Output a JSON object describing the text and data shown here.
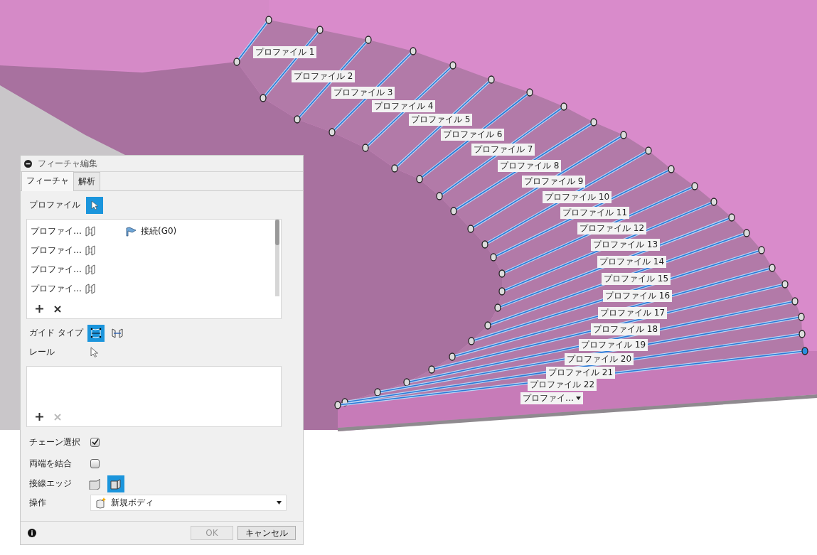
{
  "viewport": {
    "profiles": [
      {
        "label": "プロファイル 1",
        "kind": "label"
      },
      {
        "label": "プロファイル 2",
        "kind": "label"
      },
      {
        "label": "プロファイル 3",
        "kind": "label"
      },
      {
        "label": "プロファイル 4",
        "kind": "label"
      },
      {
        "label": "プロファイル 5",
        "kind": "label"
      },
      {
        "label": "プロファイル 6",
        "kind": "label"
      },
      {
        "label": "プロファイル 7",
        "kind": "label"
      },
      {
        "label": "プロファイル 8",
        "kind": "label"
      },
      {
        "label": "プロファイル 9",
        "kind": "label"
      },
      {
        "label": "プロファイル 10",
        "kind": "label"
      },
      {
        "label": "プロファイル 11",
        "kind": "label"
      },
      {
        "label": "プロファイル 12",
        "kind": "label"
      },
      {
        "label": "プロファイル 13",
        "kind": "label"
      },
      {
        "label": "プロファイル 14",
        "kind": "label"
      },
      {
        "label": "プロファイル 15",
        "kind": "label"
      },
      {
        "label": "プロファイル 16",
        "kind": "label"
      },
      {
        "label": "プロファイル 17",
        "kind": "label"
      },
      {
        "label": "プロファイル 18",
        "kind": "label"
      },
      {
        "label": "プロファイル 19",
        "kind": "label"
      },
      {
        "label": "プロファイル 20",
        "kind": "label"
      },
      {
        "label": "プロファイル 21",
        "kind": "label"
      },
      {
        "label": "プロファイル 22",
        "kind": "label"
      },
      {
        "label": "プロファイ…",
        "kind": "dropdown"
      }
    ]
  },
  "dialog": {
    "title": "フィーチャ編集",
    "tabs": [
      {
        "label": "フィーチャ",
        "selected": true
      },
      {
        "label": "解析",
        "selected": false
      }
    ],
    "profile_label": "プロファイル",
    "profile_rows": [
      {
        "name": "プロファイ…",
        "condition": "接続(G0)"
      },
      {
        "name": "プロファイ…"
      },
      {
        "name": "プロファイ…"
      },
      {
        "name": "プロファイ…"
      }
    ],
    "profile_list": {
      "remove_disabled": false
    },
    "guide_type": {
      "label": "ガイド タイプ",
      "options": [
        {
          "kind": "rails",
          "selected": true
        },
        {
          "kind": "centerline",
          "selected": false
        }
      ]
    },
    "rail_label": "レール",
    "rail_list": {
      "remove_disabled": true
    },
    "chain_select": {
      "label": "チェーン選択",
      "checked": true
    },
    "close_ends": {
      "label": "両端を結合",
      "checked": false
    },
    "tangent_edges": {
      "label": "接線エッジ",
      "options": [
        {
          "kind": "merge",
          "selected": false
        },
        {
          "kind": "keep",
          "selected": true
        }
      ]
    },
    "operation": {
      "label": "操作",
      "value": "新規ボディ"
    },
    "buttons": [
      {
        "label": "OK",
        "disabled": true
      },
      {
        "label": "キャンセル",
        "disabled": false
      }
    ]
  }
}
